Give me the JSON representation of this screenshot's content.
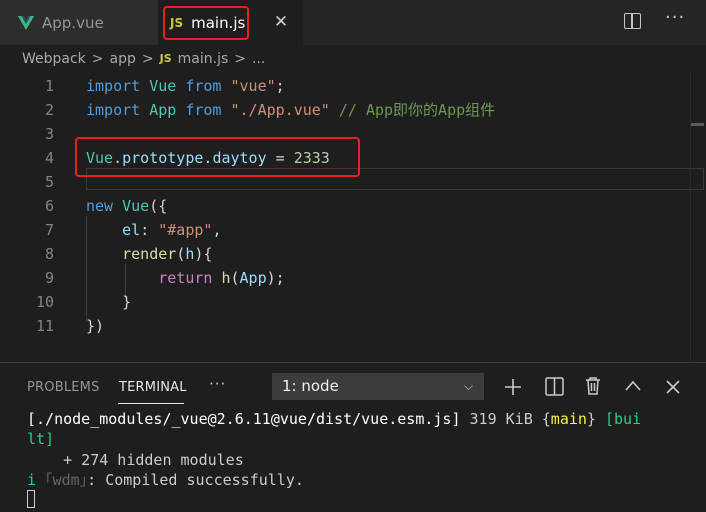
{
  "tabs": [
    {
      "label": "App.vue",
      "icon": "vue-icon",
      "active": false
    },
    {
      "label": "main.js",
      "icon": "js-icon",
      "icon_text": "JS",
      "active": true
    }
  ],
  "tab_close_glyph": "✕",
  "breadcrumb": {
    "items": [
      "Webpack",
      "app",
      "main.js",
      "..."
    ],
    "sep": ">",
    "js_icon_text": "JS"
  },
  "editor": {
    "lines": [
      {
        "n": "1",
        "tokens": [
          [
            "k",
            "import"
          ],
          [
            "d",
            " "
          ],
          [
            "v",
            "Vue"
          ],
          [
            "d",
            " "
          ],
          [
            "k",
            "from"
          ],
          [
            "d",
            " "
          ],
          [
            "s",
            "\"vue\""
          ],
          [
            "d",
            ";"
          ]
        ]
      },
      {
        "n": "2",
        "tokens": [
          [
            "k",
            "import"
          ],
          [
            "d",
            " "
          ],
          [
            "v",
            "App"
          ],
          [
            "d",
            " "
          ],
          [
            "k",
            "from"
          ],
          [
            "d",
            " "
          ],
          [
            "s",
            "\"./App.vue\""
          ],
          [
            "d",
            " "
          ],
          [
            "c",
            "// App即你的App组件"
          ]
        ]
      },
      {
        "n": "3",
        "tokens": []
      },
      {
        "n": "4",
        "tokens": [
          [
            "v",
            "Vue"
          ],
          [
            "d",
            "."
          ],
          [
            "p",
            "prototype"
          ],
          [
            "d",
            "."
          ],
          [
            "p",
            "daytoy"
          ],
          [
            "d",
            " = "
          ],
          [
            "n",
            "2333"
          ]
        ]
      },
      {
        "n": "5",
        "tokens": []
      },
      {
        "n": "6",
        "tokens": [
          [
            "k",
            "new"
          ],
          [
            "d",
            " "
          ],
          [
            "v",
            "Vue"
          ],
          [
            "d",
            "({"
          ]
        ]
      },
      {
        "n": "7",
        "tokens": [
          [
            "d",
            "    "
          ],
          [
            "p",
            "el"
          ],
          [
            "d",
            ": "
          ],
          [
            "s",
            "\"#app\""
          ],
          [
            "d",
            ","
          ]
        ]
      },
      {
        "n": "8",
        "tokens": [
          [
            "d",
            "    "
          ],
          [
            "f",
            "render"
          ],
          [
            "d",
            "("
          ],
          [
            "p",
            "h"
          ],
          [
            "d",
            "){"
          ]
        ]
      },
      {
        "n": "9",
        "tokens": [
          [
            "d",
            "        "
          ],
          [
            "r",
            "return"
          ],
          [
            "d",
            " "
          ],
          [
            "f",
            "h"
          ],
          [
            "d",
            "("
          ],
          [
            "p",
            "App"
          ],
          [
            "d",
            ");"
          ]
        ]
      },
      {
        "n": "10",
        "tokens": [
          [
            "d",
            "    }"
          ]
        ]
      },
      {
        "n": "11",
        "tokens": [
          [
            "d",
            "})"
          ]
        ]
      }
    ]
  },
  "panel": {
    "tabs": [
      "PROBLEMS",
      "TERMINAL"
    ],
    "active_tab": "TERMINAL",
    "more": "···",
    "terminal_select": "1: node",
    "icons": [
      "plus-icon",
      "split-terminal-icon",
      "trash-icon",
      "chevron-up-icon",
      "close-icon"
    ]
  },
  "terminal": {
    "line1": [
      [
        "tb",
        "[./node_modules/_vue@2.6.11@vue/dist/vue.esm.js]"
      ],
      [
        "tw",
        " 319 KiB {"
      ],
      [
        "ty",
        "main"
      ],
      [
        "tw",
        "} "
      ],
      [
        "tg",
        "[bui"
      ]
    ],
    "line2": [
      [
        "tg",
        "lt]"
      ]
    ],
    "line3": [
      [
        "tw",
        "    + 274 hidden modules"
      ]
    ],
    "line4": [
      [
        "tc",
        "i"
      ],
      [
        "tgray",
        " ｢wdm｣"
      ],
      [
        "tw",
        ": Compiled successfully."
      ]
    ]
  },
  "colors": {
    "highlight_box": "#e8231a",
    "accent_js": "#cbcb41",
    "vue_green": "#41b883"
  }
}
